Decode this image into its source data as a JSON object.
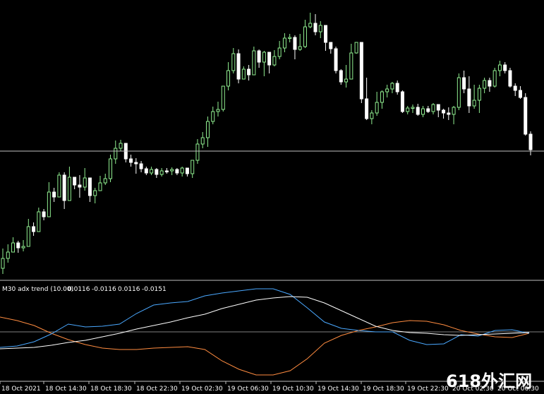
{
  "chart_data": [
    {
      "type": "candlestick",
      "timeframe": "M30",
      "bull_color": "#90ee90",
      "bear_color": "#ffffff",
      "candles": [
        [
          380,
          366,
          388,
          352
        ],
        [
          366,
          357,
          372,
          346
        ],
        [
          357,
          344,
          356,
          336
        ],
        [
          344,
          351,
          358,
          341
        ],
        [
          351,
          349,
          356,
          340
        ],
        [
          349,
          321,
          346,
          310
        ],
        [
          321,
          328,
          334,
          315
        ],
        [
          328,
          300,
          326,
          294
        ],
        [
          300,
          307,
          312,
          296
        ],
        [
          307,
          272,
          302,
          258
        ],
        [
          272,
          279,
          286,
          266
        ],
        [
          279,
          248,
          276,
          244
        ],
        [
          248,
          284,
          296,
          244
        ],
        [
          284,
          251,
          280,
          236
        ],
        [
          251,
          262,
          268,
          256
        ],
        [
          262,
          265,
          280,
          248
        ],
        [
          265,
          252,
          270,
          238
        ],
        [
          252,
          277,
          286,
          268
        ],
        [
          277,
          270,
          288,
          266
        ],
        [
          270,
          259,
          268,
          249
        ],
        [
          259,
          253,
          262,
          246
        ],
        [
          253,
          225,
          258,
          219
        ],
        [
          225,
          210,
          232,
          199
        ],
        [
          210,
          203,
          214,
          198
        ],
        [
          203,
          225,
          230,
          214
        ],
        [
          225,
          230,
          236,
          219
        ],
        [
          230,
          232,
          246,
          224
        ],
        [
          232,
          239,
          244,
          228
        ],
        [
          239,
          245,
          248,
          236
        ],
        [
          245,
          240,
          248,
          236
        ],
        [
          240,
          247,
          252,
          238
        ],
        [
          247,
          242,
          250,
          238
        ],
        [
          242,
          242,
          246,
          238
        ],
        [
          242,
          240,
          248,
          237
        ],
        [
          240,
          245,
          248,
          238
        ],
        [
          245,
          238,
          250,
          236
        ],
        [
          238,
          246,
          250,
          242
        ],
        [
          246,
          227,
          252,
          232
        ],
        [
          227,
          204,
          232,
          197
        ],
        [
          204,
          195,
          210,
          187
        ],
        [
          195,
          172,
          208,
          165
        ],
        [
          172,
          158,
          176,
          151
        ],
        [
          158,
          155,
          165,
          144
        ],
        [
          155,
          122,
          158,
          122
        ],
        [
          122,
          100,
          128,
          88
        ],
        [
          100,
          76,
          104,
          68
        ],
        [
          76,
          112,
          118,
          70
        ],
        [
          112,
          98,
          108,
          94
        ],
        [
          98,
          106,
          114,
          92
        ],
        [
          106,
          72,
          104,
          66
        ],
        [
          72,
          88,
          96,
          70
        ],
        [
          88,
          74,
          108,
          72
        ],
        [
          74,
          92,
          104,
          78
        ],
        [
          92,
          80,
          94,
          71
        ],
        [
          80,
          68,
          84,
          58
        ],
        [
          68,
          54,
          74,
          47
        ],
        [
          54,
          53,
          60,
          48
        ],
        [
          53,
          70,
          84,
          50
        ],
        [
          70,
          66,
          72,
          48
        ],
        [
          66,
          38,
          68,
          28
        ],
        [
          38,
          33,
          40,
          18
        ],
        [
          33,
          45,
          50,
          20
        ],
        [
          45,
          36,
          54,
          30
        ],
        [
          36,
          60,
          72,
          50
        ],
        [
          60,
          69,
          76,
          60
        ],
        [
          69,
          100,
          104,
          66
        ],
        [
          100,
          116,
          120,
          98
        ],
        [
          116,
          112,
          124,
          92
        ],
        [
          112,
          75,
          98,
          62
        ],
        [
          75,
          60,
          76,
          62
        ],
        [
          60,
          140,
          146,
          72
        ],
        [
          140,
          168,
          170,
          110
        ],
        [
          168,
          160,
          176,
          156
        ],
        [
          160,
          145,
          164,
          130
        ],
        [
          145,
          130,
          154,
          128
        ],
        [
          130,
          126,
          138,
          120
        ],
        [
          126,
          118,
          132,
          116
        ],
        [
          118,
          130,
          134,
          114
        ],
        [
          130,
          158,
          160,
          128
        ],
        [
          158,
          153,
          162,
          150
        ],
        [
          153,
          152,
          160,
          148
        ],
        [
          152,
          162,
          164,
          147
        ],
        [
          162,
          154,
          166,
          150
        ],
        [
          154,
          158,
          160,
          150
        ],
        [
          158,
          148,
          162,
          146
        ],
        [
          148,
          156,
          166,
          148
        ],
        [
          156,
          160,
          168,
          154
        ],
        [
          160,
          162,
          170,
          152
        ],
        [
          162,
          152,
          176,
          150
        ],
        [
          152,
          110,
          156,
          104
        ],
        [
          110,
          126,
          132,
          100
        ],
        [
          126,
          150,
          160,
          108
        ],
        [
          150,
          142,
          154,
          120
        ],
        [
          142,
          125,
          160,
          120
        ],
        [
          125,
          114,
          132,
          110
        ],
        [
          114,
          122,
          130,
          110
        ],
        [
          122,
          100,
          124,
          96
        ],
        [
          100,
          92,
          108,
          86
        ],
        [
          92,
          100,
          104,
          88
        ],
        [
          100,
          122,
          124,
          96
        ],
        [
          122,
          128,
          136,
          118
        ],
        [
          128,
          138,
          140,
          122
        ],
        [
          138,
          190,
          192,
          132
        ],
        [
          190,
          212,
          220,
          186
        ]
      ],
      "hline": 214,
      "indicator": {
        "name": "M30 adx trend (10.00)",
        "values": [
          "0.0116",
          "-0.0116",
          "0.0116",
          "-0.0151"
        ],
        "blue": [
          492,
          490,
          484,
          473,
          459,
          463,
          462,
          459,
          444,
          432,
          429,
          427,
          419,
          415,
          412,
          409,
          409,
          417,
          436,
          456,
          465,
          468,
          470,
          470,
          482,
          488,
          487,
          474,
          476,
          468,
          467,
          472
        ],
        "orange": [
          449,
          454,
          461,
          472,
          481,
          488,
          493,
          495,
          495,
          493,
          492,
          491,
          495,
          511,
          523,
          531,
          531,
          525,
          508,
          486,
          475,
          468,
          463,
          457,
          454,
          455,
          460,
          468,
          473,
          477,
          478,
          472
        ],
        "white": [
          494,
          493,
          492,
          489,
          485,
          482,
          477,
          472,
          466,
          461,
          456,
          450,
          445,
          437,
          431,
          425,
          422,
          420,
          421,
          429,
          440,
          451,
          462,
          468,
          471,
          472,
          474,
          475,
          474,
          473,
          472,
          471
        ],
        "zero_level": 470
      },
      "x_ticks": [
        "18 Oct 2021",
        "18 Oct 14:30",
        "18 Oct 18:30",
        "18 Oct 22:30",
        "19 Oct 02:30",
        "19 Oct 06:30",
        "19 Oct 10:30",
        "19 Oct 14:30",
        "19 Oct 18:30",
        "19 Oct 22:30",
        "20 Oct 02:30",
        "20 Oct 06:30"
      ],
      "watermark": "618外汇网"
    }
  ]
}
